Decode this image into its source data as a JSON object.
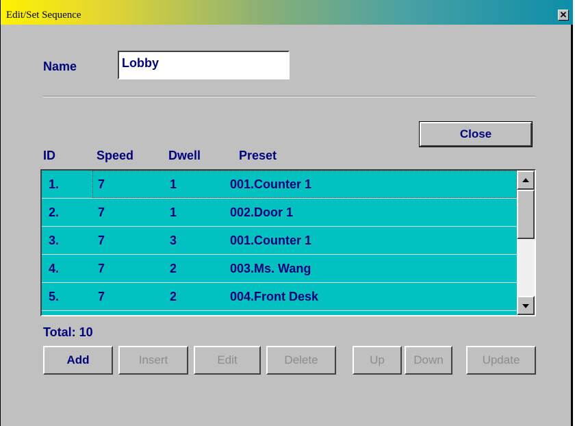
{
  "window": {
    "title": "Edit/Set Sequence",
    "close_glyph": "✕"
  },
  "form": {
    "name_label": "Name",
    "name_value": "Lobby"
  },
  "close_button": "Close",
  "table": {
    "headers": {
      "id": "ID",
      "speed": "Speed",
      "dwell": "Dwell",
      "preset": "Preset"
    },
    "rows": [
      {
        "id": "1.",
        "speed": "7",
        "dwell": "1",
        "preset": "001.Counter 1"
      },
      {
        "id": "2.",
        "speed": "7",
        "dwell": "1",
        "preset": "002.Door 1"
      },
      {
        "id": "3.",
        "speed": "7",
        "dwell": "3",
        "preset": "001.Counter 1"
      },
      {
        "id": "4.",
        "speed": "7",
        "dwell": "2",
        "preset": "003.Ms. Wang"
      },
      {
        "id": "5.",
        "speed": "7",
        "dwell": "2",
        "preset": "004.Front Desk"
      }
    ]
  },
  "total_label": "Total: 10",
  "buttons": {
    "add": "Add",
    "insert": "Insert",
    "edit": "Edit",
    "delete": "Delete",
    "up": "Up",
    "down": "Down",
    "update": "Update"
  },
  "colors": {
    "list_bg": "#00c0c0",
    "text": "#00007a",
    "dialog_bg": "#c0c0c0"
  }
}
